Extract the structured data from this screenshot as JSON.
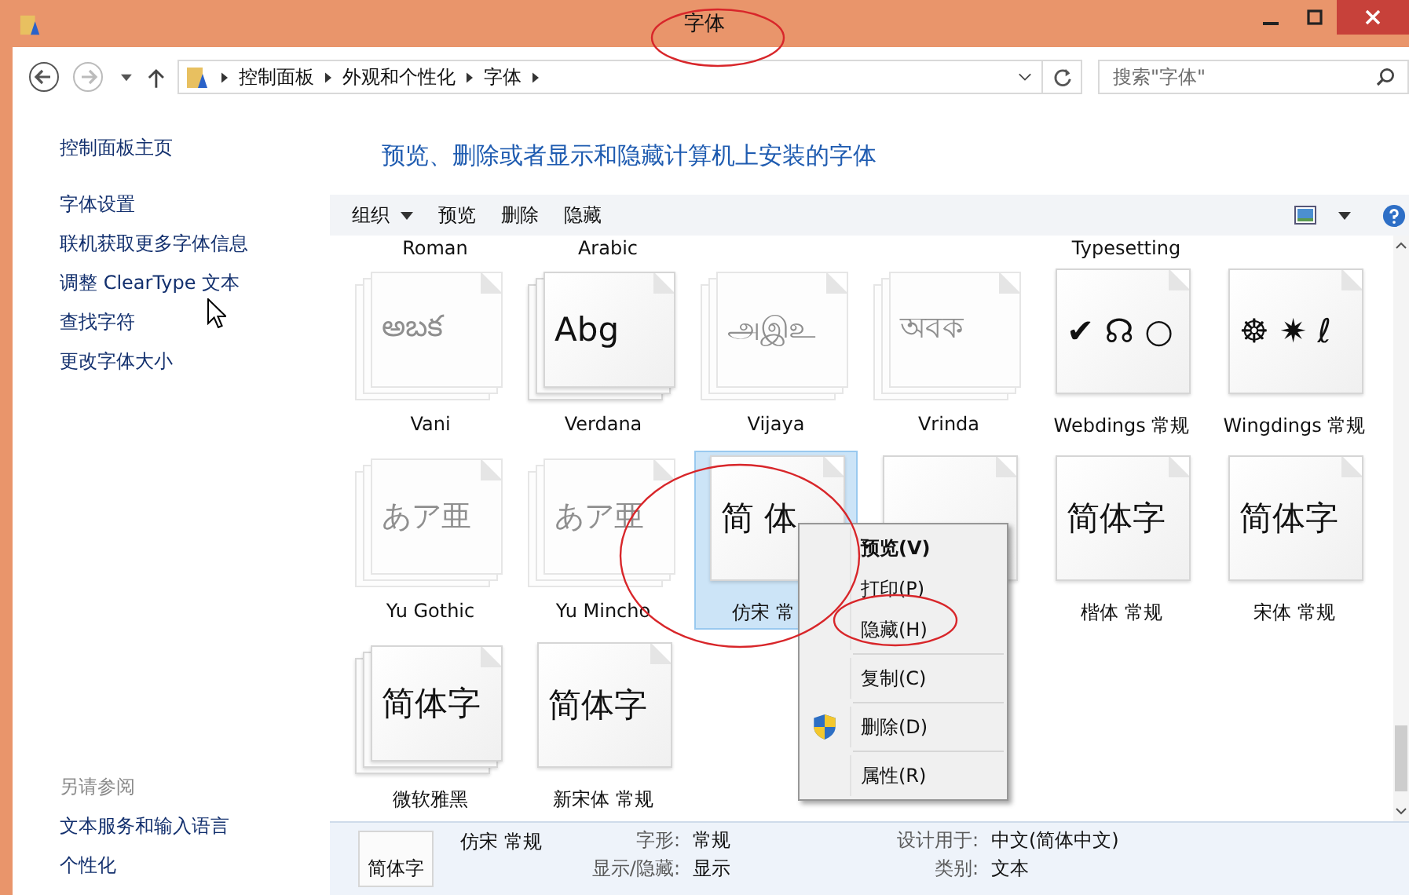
{
  "window": {
    "title": "字体"
  },
  "address": {
    "breadcrumbs": [
      "控制面板",
      "外观和个性化",
      "字体"
    ],
    "search_placeholder": "搜索\"字体\""
  },
  "sidebar": {
    "home": "控制面板主页",
    "items": [
      "字体设置",
      "联机获取更多字体信息",
      "调整 ClearType 文本",
      "查找字符",
      "更改字体大小"
    ],
    "see_also_title": "另请参阅",
    "see_also": [
      "文本服务和输入语言",
      "个性化"
    ]
  },
  "heading": "预览、删除或者显示和隐藏计算机上安装的字体",
  "toolbar": {
    "organize": "组织",
    "buttons": [
      "预览",
      "删除",
      "隐藏"
    ]
  },
  "clipped_labels": [
    {
      "kind": "label",
      "label": "Roman"
    },
    {
      "kind": "label",
      "label": "Arabic"
    },
    {
      "kind": "gap"
    },
    {
      "kind": "gap"
    },
    {
      "kind": "label",
      "label": "Typesetting"
    },
    {
      "kind": "gap"
    }
  ],
  "fonts": [
    {
      "name": "Vani",
      "sample": "అబక",
      "hidden": true,
      "stacked": true,
      "selected": false
    },
    {
      "name": "Verdana",
      "sample": "Abg",
      "hidden": false,
      "stacked": true,
      "selected": false
    },
    {
      "name": "Vijaya",
      "sample": "அஇஉ",
      "hidden": true,
      "stacked": true,
      "selected": false
    },
    {
      "name": "Vrinda",
      "sample": "অবক",
      "hidden": true,
      "stacked": true,
      "selected": false
    },
    {
      "name": "Webdings 常规",
      "sample": "✔ ☊ ○",
      "hidden": false,
      "stacked": false,
      "selected": false
    },
    {
      "name": "Wingdings 常规",
      "sample": "☸ ✷ ℓ",
      "hidden": false,
      "stacked": false,
      "selected": false
    },
    {
      "name": "Yu Gothic",
      "sample": "あア亜",
      "hidden": true,
      "stacked": true,
      "selected": false
    },
    {
      "name": "Yu Mincho",
      "sample": "あア亜",
      "hidden": true,
      "stacked": true,
      "selected": false
    },
    {
      "name": "仿宋 常",
      "sample": "简 体",
      "hidden": false,
      "stacked": false,
      "selected": true
    },
    {
      "hidden": false,
      "stacked": false,
      "selected": false
    },
    {
      "name": "楷体 常规",
      "sample": "简体字",
      "hidden": false,
      "stacked": false,
      "selected": false
    },
    {
      "name": "宋体 常规",
      "sample": "简体字",
      "hidden": false,
      "stacked": false,
      "selected": false
    },
    {
      "name": "微软雅黑",
      "sample": "简体字",
      "hidden": false,
      "stacked": true,
      "selected": false
    },
    {
      "name": "新宋体 常规",
      "sample": "简体字",
      "hidden": false,
      "stacked": false,
      "selected": false
    }
  ],
  "context_menu": [
    {
      "label": "预览(V)",
      "kind": "default"
    },
    {
      "label": "打印(P)",
      "kind": "item"
    },
    {
      "label": "隐藏(H)",
      "kind": "item"
    },
    {
      "kind": "separator"
    },
    {
      "label": "复制(C)",
      "kind": "item"
    },
    {
      "kind": "separator"
    },
    {
      "label": "删除(D)",
      "kind": "shield"
    },
    {
      "kind": "separator"
    },
    {
      "label": "属性(R)",
      "kind": "item"
    }
  ],
  "details": {
    "sample": "简体字",
    "name": "仿宋 常规",
    "fields": [
      {
        "label": "字形:",
        "value": "常规"
      },
      {
        "label": "设计用于:",
        "value": "中文(简体中文)"
      },
      {
        "label": "显示/隐藏:",
        "value": "显示"
      },
      {
        "label": "类别:",
        "value": "文本"
      }
    ]
  }
}
